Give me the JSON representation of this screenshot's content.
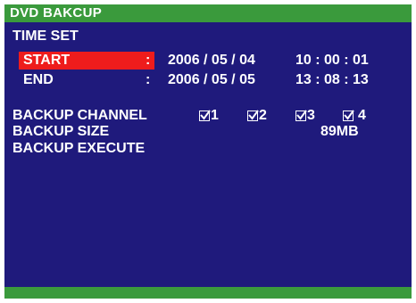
{
  "title": "DVD BAKCUP",
  "section": "TIME SET",
  "start": {
    "label": "START",
    "sep": ":",
    "date": "2006 / 05 / 04",
    "time": "10 : 00 : 01"
  },
  "end": {
    "label": "END",
    "sep": ":",
    "date": "2006 / 05 / 05",
    "time": "13 : 08 : 13"
  },
  "backup_channel": {
    "label": "BACKUP CHANNEL",
    "channels": [
      {
        "label": "1",
        "checked": true
      },
      {
        "label": "2",
        "checked": true
      },
      {
        "label": "3",
        "checked": true
      },
      {
        "label": "4",
        "checked": true
      }
    ]
  },
  "backup_size": {
    "label": "BACKUP SIZE",
    "value": "89MB"
  },
  "backup_execute": {
    "label": "BACKUP EXECUTE"
  },
  "colors": {
    "background": "#1f1a7c",
    "bar": "#3a9a3c",
    "highlight": "#ee1c1c",
    "text": "#ffffff"
  }
}
